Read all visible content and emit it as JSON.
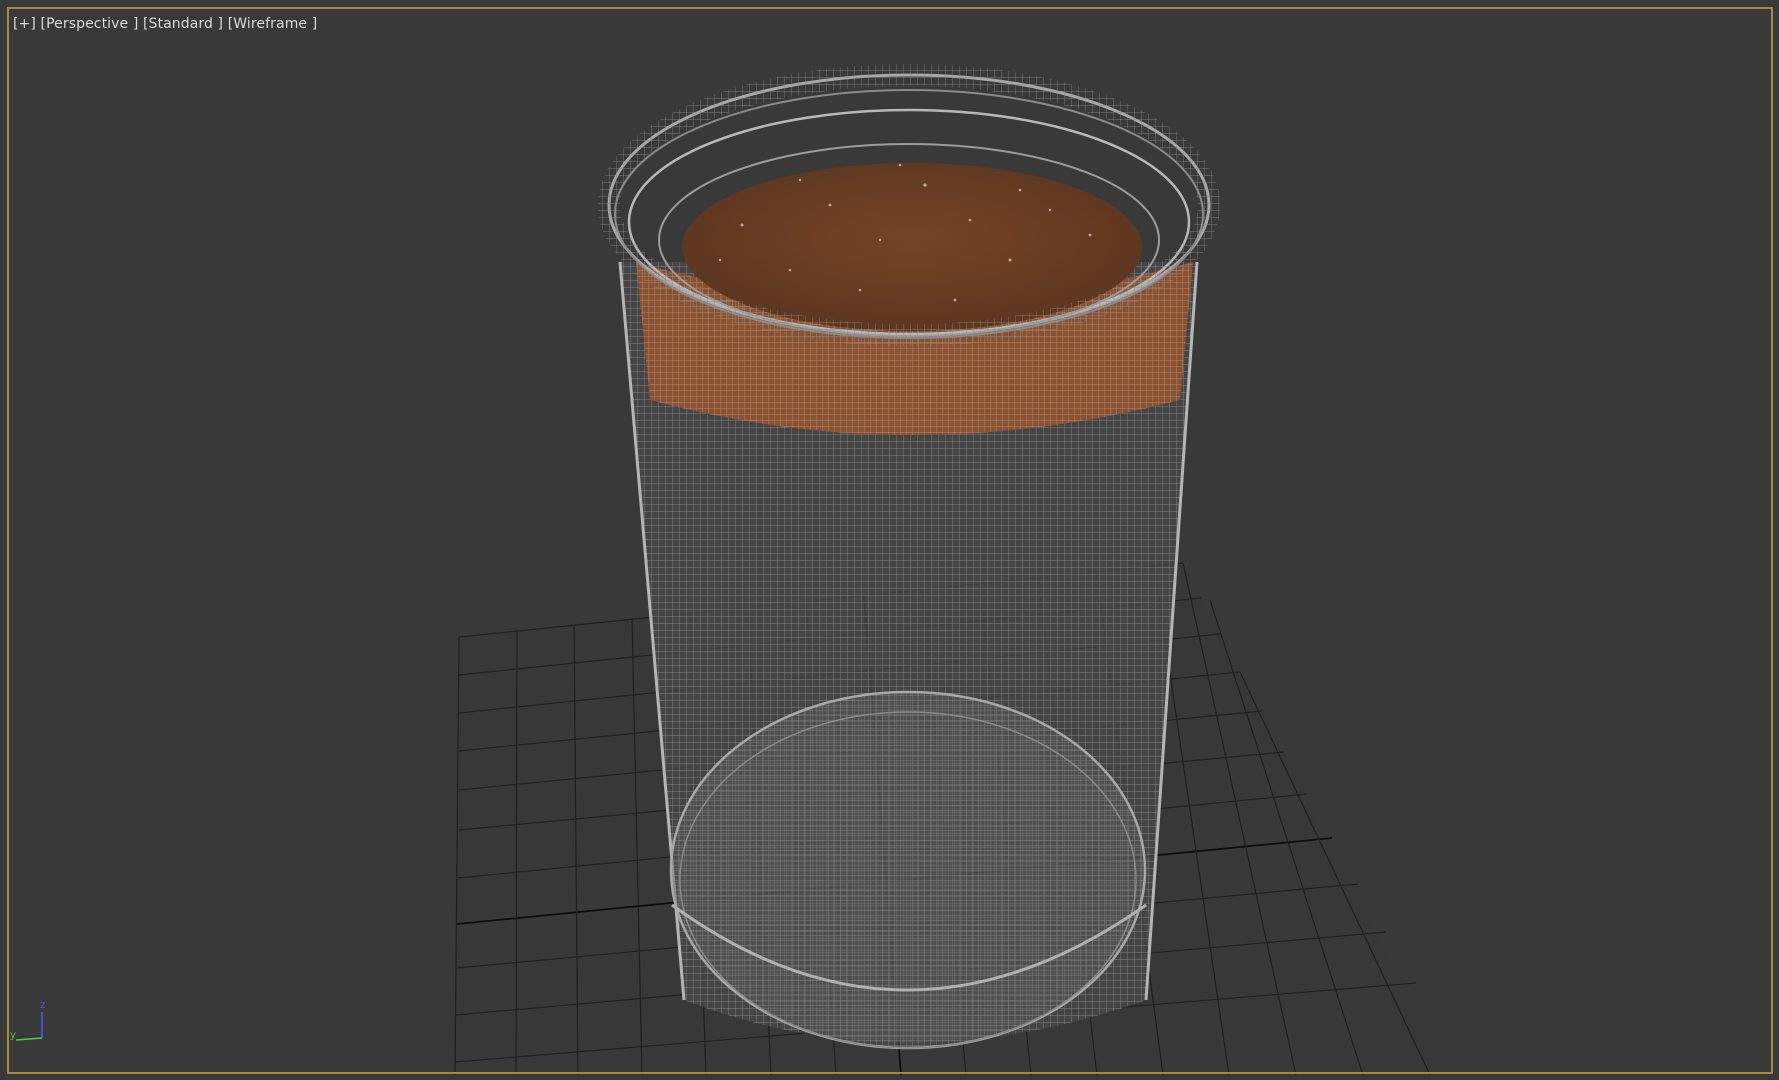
{
  "viewport": {
    "menu_label": "[+]",
    "view_label": "[Perspective ]",
    "shading_preset_label": "[Standard ]",
    "display_mode_label": "[Wireframe ]",
    "active_border_color": "#a48a3e",
    "background_color": "#393939"
  },
  "scene": {
    "object": "cylindrical jar wireframe",
    "wire_color": "#9a9a9a",
    "content_color": "#7a4a2a",
    "grid_color": "#1e1e1e"
  },
  "axis_gizmo": {
    "z_label": "z",
    "y_label": "y",
    "z_color": "#4f5cff",
    "y_color": "#49d049"
  }
}
